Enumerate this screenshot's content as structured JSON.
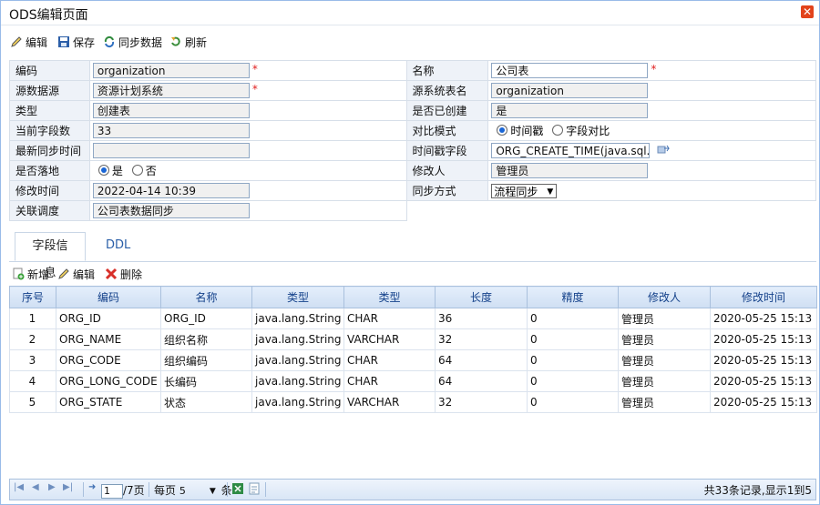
{
  "window": {
    "title": "ODS编辑页面",
    "close_icon": "close-icon"
  },
  "toolbar": {
    "edit": "编辑",
    "save": "保存",
    "sync": "同步数据",
    "refresh": "刷新"
  },
  "form": {
    "code_label": "编码",
    "code_value": "organization",
    "name_label": "名称",
    "name_value": "公司表",
    "source_label": "源数据源",
    "source_value": "资源计划系统",
    "source_table_label": "源系统表名",
    "source_table_value": "organization",
    "type_label": "类型",
    "type_value": "创建表",
    "created_label": "是否已创建",
    "created_value": "是",
    "field_count_label": "当前字段数",
    "field_count_value": "33",
    "compare_label": "对比模式",
    "compare_opt1": "时间戳",
    "compare_opt2": "字段对比",
    "last_sync_label": "最新同步时间",
    "last_sync_value": "",
    "ts_field_label": "时间戳字段",
    "ts_field_value": "ORG_CREATE_TIME(java.sql.Ti",
    "landing_label": "是否落地",
    "landing_yes": "是",
    "landing_no": "否",
    "modifier_label": "修改人",
    "modifier_value": "管理员",
    "modtime_label": "修改时间",
    "modtime_value": "2022-04-14 10:39",
    "sync_mode_label": "同步方式",
    "sync_mode_value": "流程同步",
    "schedule_label": "关联调度",
    "schedule_value": "公司表数据同步",
    "required_mark": "*"
  },
  "tabs": {
    "fields": "字段信息",
    "ddl": "DDL"
  },
  "grid_toolbar": {
    "add": "新增",
    "edit": "编辑",
    "delete": "删除"
  },
  "grid": {
    "headers": [
      "序号",
      "编码",
      "名称",
      "类型",
      "类型",
      "长度",
      "精度",
      "修改人",
      "修改时间"
    ],
    "rows": [
      [
        "1",
        "ORG_ID",
        "ORG_ID",
        "java.lang.String",
        "CHAR",
        "36",
        "0",
        "管理员",
        "2020-05-25 15:13"
      ],
      [
        "2",
        "ORG_NAME",
        "组织名称",
        "java.lang.String",
        "VARCHAR",
        "32",
        "0",
        "管理员",
        "2020-05-25 15:13"
      ],
      [
        "3",
        "ORG_CODE",
        "组织编码",
        "java.lang.String",
        "CHAR",
        "64",
        "0",
        "管理员",
        "2020-05-25 15:13"
      ],
      [
        "4",
        "ORG_LONG_CODE",
        "长编码",
        "java.lang.String",
        "CHAR",
        "64",
        "0",
        "管理员",
        "2020-05-25 15:13"
      ],
      [
        "5",
        "ORG_STATE",
        "状态",
        "java.lang.String",
        "VARCHAR",
        "32",
        "0",
        "管理员",
        "2020-05-25 15:13"
      ]
    ]
  },
  "pager": {
    "page_input": "1",
    "total_pages": "/7页",
    "per_page_label": "每页",
    "per_page_value": "5",
    "unit": "条",
    "summary": "共33条记录,显示1到5"
  }
}
